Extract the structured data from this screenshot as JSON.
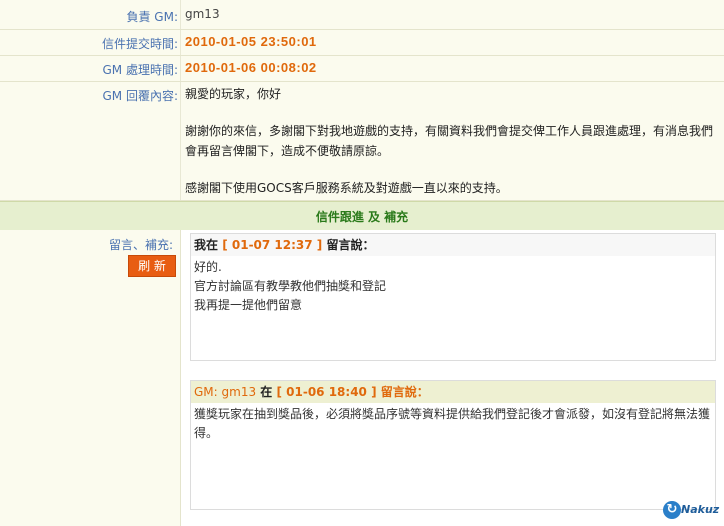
{
  "rows": {
    "gm_label": "負責 GM:",
    "gm_value": "gm13",
    "submit_label": "信件提交時間:",
    "submit_value": "2010-01-05 23:50:01",
    "process_label": "GM 處理時間:",
    "process_value": "2010-01-06 00:08:02",
    "reply_label": "GM 回覆內容:",
    "reply_lines": [
      "親愛的玩家，你好",
      "謝謝你的來信，多謝閣下對我地遊戲的支持，有關資料我們會提交俾工作人員跟進處理，有消息我們",
      "會再留言俾閣下，造成不便敬請原諒。",
      "感謝閣下使用GOCS客戶服務系統及對遊戲一直以來的支持。"
    ]
  },
  "section": {
    "title": "信件跟進 及 補充"
  },
  "followup": {
    "label": "留言、補充:",
    "refresh_label": "刷 新",
    "messages": [
      {
        "prefix": "我在",
        "time": "[ 01-07 12:37 ]",
        "suffix": "留言說：",
        "lines": [
          "好的.",
          "官方討論區有教學教他們抽獎和登記",
          "我再提一提他們留意"
        ]
      },
      {
        "author": "GM: gm13",
        "prefix": "在",
        "time": "[ 01-06 18:40 ]",
        "suffix": "留言說：",
        "lines": [
          "獲獎玩家在抽到獎品後，必須將獎品序號等資料提供給我們登記後才會派發，如沒有登記將無法獲",
          "得。"
        ]
      }
    ]
  },
  "watermark": {
    "icon": "nakuz-logo-icon",
    "text": "Nakuz"
  },
  "colors": {
    "accent": "#e0690c",
    "label": "#4a72b0",
    "section_text": "#2a7a1a",
    "button": "#e85d12"
  }
}
